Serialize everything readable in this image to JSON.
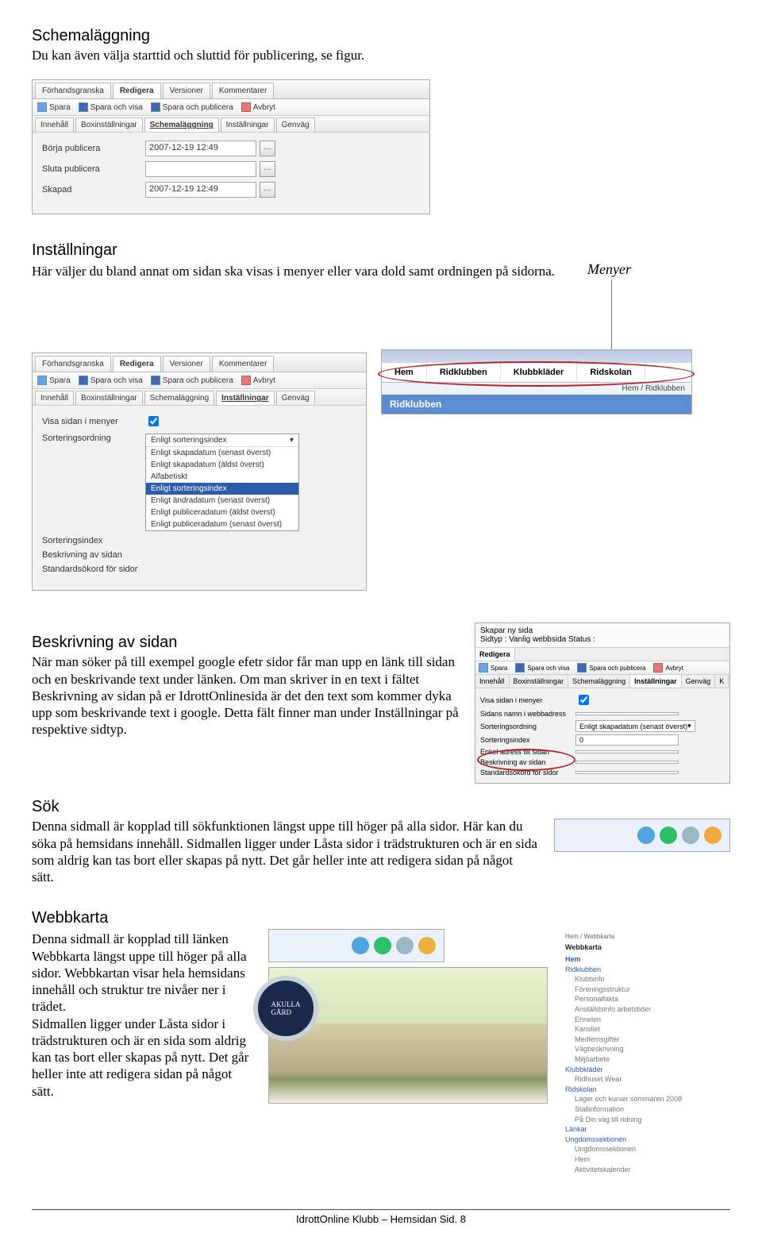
{
  "headings": {
    "schemalaggning": "Schemaläggning",
    "installningar": "Inställningar",
    "beskrivning": "Beskrivning av sidan",
    "sok": "Sök",
    "webbkarta": "Webbkarta"
  },
  "paragraphs": {
    "schemalaggning": "Du kan även välja starttid och sluttid för publicering, se figur.",
    "installningar": "Här väljer du bland annat om sidan ska visas i menyer eller vara dold samt ordningen på sidorna.",
    "beskrivning": "När man söker på till exempel google efetr sidor får man upp en länk till sidan och en beskrivande text under länken. Om man skriver in en text i fältet Beskrivning av sidan på er IdrottOnlinesida är det den text som kommer dyka upp som beskrivande text i google. Detta fält finner man under Inställningar på respektive sidtyp.",
    "sok": "Denna sidmall är kopplad till sökfunktionen längst uppe till höger på alla sidor. Här kan du söka på hemsidans innehåll. Sidmallen ligger under Låsta sidor i trädstrukturen och är en sida som aldrig kan tas bort eller skapas på nytt. Det går heller inte att redigera sidan på något sätt.",
    "webbkarta": "Denna sidmall är kopplad till länken Webbkarta längst uppe till höger på alla sidor. Webbkartan visar hela hemsidans innehåll och struktur tre nivåer ner i trädet.\nSidmallen ligger under Låsta sidor i trädstrukturen och är en sida som aldrig kan tas bort eller skapas på nytt. Det går heller inte att redigera sidan på något sätt."
  },
  "editor": {
    "top_tabs": [
      "Förhandsgranska",
      "Redigera",
      "Versioner",
      "Kommentarer"
    ],
    "top_tabs_active": "Redigera",
    "toolbar": [
      "Spara",
      "Spara och visa",
      "Spara och publicera",
      "Avbryt"
    ],
    "sub_tabs": [
      "Innehåll",
      "Boxinställningar",
      "Schemaläggning",
      "Inställningar",
      "Genväg"
    ]
  },
  "scheduling": {
    "active_tab": "Schemaläggning",
    "fields": {
      "start_label": "Börja publicera",
      "start_value": "2007-12-19 12:49",
      "end_label": "Sluta publicera",
      "end_value": "",
      "created_label": "Skapad",
      "created_value": "2007-12-19 12:49"
    }
  },
  "menyer_label": "Menyer",
  "settings_tab": {
    "active_tab": "Inställningar",
    "rows": {
      "show_in_menus": "Visa sidan i menyer",
      "sortorder": "Sorteringsordning",
      "sortindex": "Sorteringsindex",
      "desc": "Beskrivning av sidan",
      "keywords": "Standardsökord för sidor"
    },
    "dropdown_value": "Enligt sorteringsindex",
    "dropdown_options": [
      "Enligt skapadatum (senast överst)",
      "Enligt skapadatum (äldst överst)",
      "Alfabetiskt",
      "Enligt sorteringsindex",
      "Enligt ändradatum (senast överst)",
      "Enligt publiceradatum (äldst överst)",
      "Enligt publiceradatum (senast överst)"
    ],
    "dropdown_selected": "Enligt sorteringsindex"
  },
  "site_menu": {
    "tabs": [
      "Hem",
      "Ridklubben",
      "Klubbkläder",
      "Ridskolan"
    ],
    "sub": "Ridklubben",
    "breadcrumb": "Hem / Ridklubben"
  },
  "right_settings": {
    "header_line": "Skapar ny sida",
    "header_line2": "Sidtyp : Vanlig webbsida Status :",
    "tabs_top": [
      "Redigera"
    ],
    "toolbar": [
      "Spara",
      "Spara och visa",
      "Spara och publicera",
      "Avbryt"
    ],
    "tabs_sub": [
      "Innehåll",
      "Boxinställningar",
      "Schemaläggning",
      "Inställningar",
      "Genväg",
      "K"
    ],
    "tabs_sub_active": "Inställningar",
    "rows": [
      {
        "label": "Visa sidan i menyer",
        "val": "☑"
      },
      {
        "label": "Sidans namn i webbadress",
        "val": ""
      },
      {
        "label": "Sorteringsordning",
        "val": "Enligt skapadatum (senast överst)"
      },
      {
        "label": "Sorteringsindex",
        "val": "0"
      },
      {
        "label": "Enkel adress till sidan",
        "val": ""
      },
      {
        "label": "Beskrivning av sidan",
        "val": ""
      },
      {
        "label": "Standardsökord för sidor",
        "val": ""
      }
    ]
  },
  "webbkarta_tree": {
    "breadcrumb": "Hem / Webbkarta",
    "title": "Webbkarta",
    "root": "Hem",
    "sections": [
      {
        "name": "Ridklubben",
        "items": [
          "Klubbinfo",
          "Föreningsstruktur",
          "Personalfakta",
          "Anställdsinfo arbetstider"
        ]
      },
      {
        "name": "",
        "items": [
          "Ehnelen",
          "Kansliet",
          "Medlemsgifter",
          "Vägbeskrivning",
          "Miljöarbete"
        ]
      },
      {
        "name": "Klubbkläder",
        "items": [
          "Ridhuset Wear"
        ]
      },
      {
        "name": "Ridskolan",
        "items": [
          "Läger och kurser sommaren 2008",
          "Stallinformation",
          "På Din väg till ridning"
        ]
      },
      {
        "name": "Länkar",
        "items": []
      },
      {
        "name": "Ungdomssektionen",
        "items": [
          "Ungdomssektionen",
          "Hem",
          "Aktivitetskalender"
        ]
      }
    ]
  },
  "footer": "IdrottOnline Klubb – Hemsidan  Sid. 8"
}
